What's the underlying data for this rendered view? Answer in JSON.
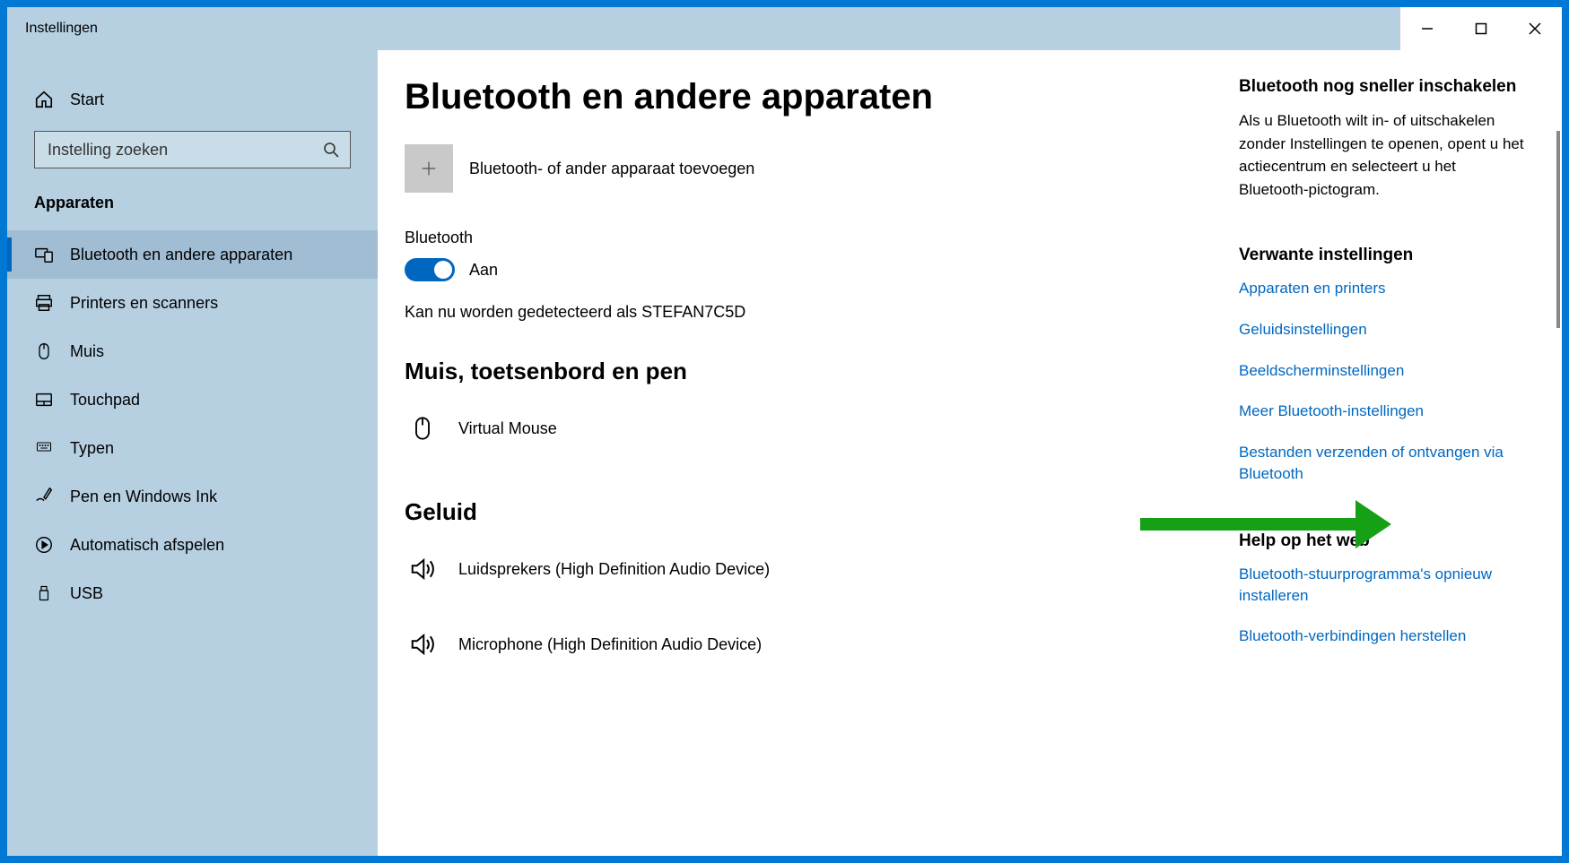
{
  "window": {
    "title": "Instellingen"
  },
  "sidebar": {
    "home": "Start",
    "search_placeholder": "Instelling zoeken",
    "section": "Apparaten",
    "items": [
      {
        "label": "Bluetooth en andere apparaten",
        "active": true
      },
      {
        "label": "Printers en scanners"
      },
      {
        "label": "Muis"
      },
      {
        "label": "Touchpad"
      },
      {
        "label": "Typen"
      },
      {
        "label": "Pen en Windows Ink"
      },
      {
        "label": "Automatisch afspelen"
      },
      {
        "label": "USB"
      }
    ]
  },
  "main": {
    "title": "Bluetooth en andere apparaten",
    "add_label": "Bluetooth- of ander apparaat toevoegen",
    "bt_label": "Bluetooth",
    "toggle_state": "Aan",
    "status": "Kan nu worden gedetecteerd als STEFAN7C5D",
    "sec_mouse": "Muis, toetsenbord en pen",
    "mouse_device": "Virtual Mouse",
    "sec_audio": "Geluid",
    "audio_speakers": "Luidsprekers (High Definition Audio Device)",
    "audio_mic": "Microphone (High Definition Audio Device)"
  },
  "aside": {
    "tip_heading": "Bluetooth nog sneller inschakelen",
    "tip_text": "Als u Bluetooth wilt in- of uitschakelen zonder Instellingen te openen, opent u het actiecentrum en selecteert u het Bluetooth-pictogram.",
    "related_heading": "Verwante instellingen",
    "links": [
      "Apparaten en printers",
      "Geluidsinstellingen",
      "Beeldscherminstellingen",
      "Meer Bluetooth-instellingen",
      "Bestanden verzenden of ontvangen via Bluetooth"
    ],
    "help_heading": "Help op het web",
    "help_links": [
      "Bluetooth-stuurprogramma's opnieuw installeren",
      "Bluetooth-verbindingen herstellen"
    ]
  }
}
